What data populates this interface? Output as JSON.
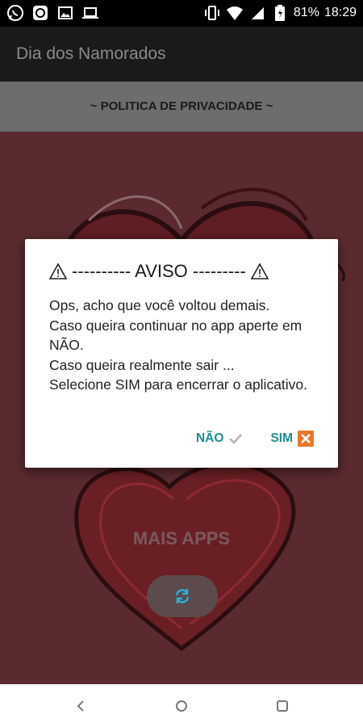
{
  "status_bar": {
    "left_icons": [
      "whatsapp-icon",
      "app-notification-icon",
      "image-icon",
      "laptop-icon"
    ],
    "right_icons": [
      "vibrate-icon",
      "wifi-icon",
      "signal-icon",
      "battery-icon"
    ],
    "battery": "81%",
    "time": "18:29"
  },
  "toolbar": {
    "title": "Dia dos Namorados"
  },
  "privacy_bar": {
    "label": "~ POLITICA DE PRIVACIDADE ~"
  },
  "main": {
    "more_apps_label": "MAIS APPS",
    "refresh_icon": "refresh-icon"
  },
  "dialog": {
    "title_icon": "warning-icon",
    "title": "---------- AVISO ---------",
    "message_lines": [
      "Ops, acho que você voltou demais.",
      "Caso queira continuar no app aperte em NÃO.",
      "Caso queira realmente sair ...",
      "Selecione SIM para encerrar o aplicativo."
    ],
    "no_label": "NÃO",
    "yes_label": "SIM"
  },
  "colors": {
    "accent": "#1a8f8f",
    "dialog_yes_icon": "#e8782a",
    "content_background": "#5a2a2e",
    "toolbar": "#1a1a1a",
    "privacy_bar": "#6d6d6d"
  },
  "nav_bar": {
    "icons": [
      "back-icon",
      "home-icon",
      "recents-icon"
    ]
  }
}
